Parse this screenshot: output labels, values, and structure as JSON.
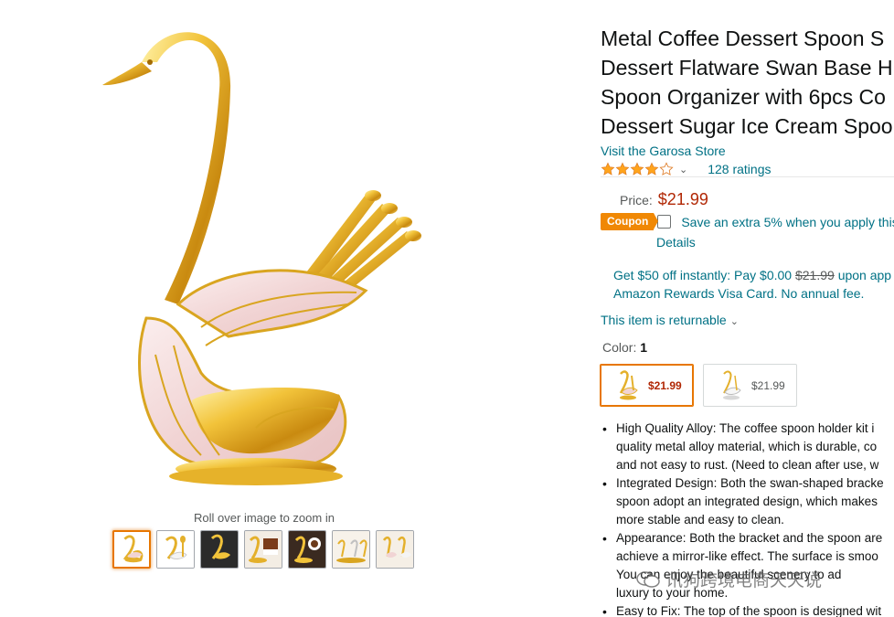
{
  "gallery": {
    "zoom_hint": "Roll over image to zoom in",
    "thumbnails": [
      "swan-gold-pink",
      "swan-gold-white",
      "swan-dark-background",
      "swan-with-dessert",
      "swan-with-coffee",
      "swan-variants",
      "swan-pair"
    ]
  },
  "product": {
    "title_lines": [
      "Metal Coffee Dessert Spoon S",
      "Dessert Flatware Swan Base H",
      "Spoon Organizer with 6pcs Co",
      "Dessert Sugar Ice Cream Spoo"
    ],
    "store_link": "Visit the Garosa Store",
    "rating_stars": 4.0,
    "ratings_count": "128 ratings",
    "price_label": "Price:",
    "price": "$21.99",
    "coupon_badge": "Coupon",
    "coupon_text": "Save an extra 5% when you apply this",
    "coupon_details": "Details",
    "card_offer_line1_prefix": "Get $50 off instantly: Pay $0.00 ",
    "card_offer_strike": "$21.99",
    "card_offer_line1_suffix": " upon app",
    "card_offer_line2": "Amazon Rewards Visa Card. No annual fee.",
    "returnable": "This item is returnable",
    "color_label": "Color: ",
    "color_value": "1",
    "swatches": [
      {
        "price": "$21.99",
        "selected": true
      },
      {
        "price": "$21.99",
        "selected": false
      }
    ],
    "bullets": [
      [
        "High Quality Alloy: The coffee spoon holder kit i",
        "quality metal alloy material, which is durable, co",
        "and not easy to rust. (Need to clean after use, w"
      ],
      [
        "Integrated Design: Both the swan-shaped bracke",
        "spoon adopt an integrated design, which makes",
        "more stable and easy to clean."
      ],
      [
        "Appearance: Both the bracket and the spoon are",
        "achieve a mirror-like effect. The surface is smoo",
        "You can enjoy the beautiful scenery to ad",
        "luxury to your home."
      ],
      [
        "Easy to Fix: The top of the spoon is designed wit"
      ]
    ]
  },
  "watermark": "讯狗跨境电商天天说",
  "colors": {
    "link": "#007185",
    "price": "#b12704",
    "coupon": "#f08804",
    "selected_border": "#e77600",
    "star": "#ffa41c"
  }
}
